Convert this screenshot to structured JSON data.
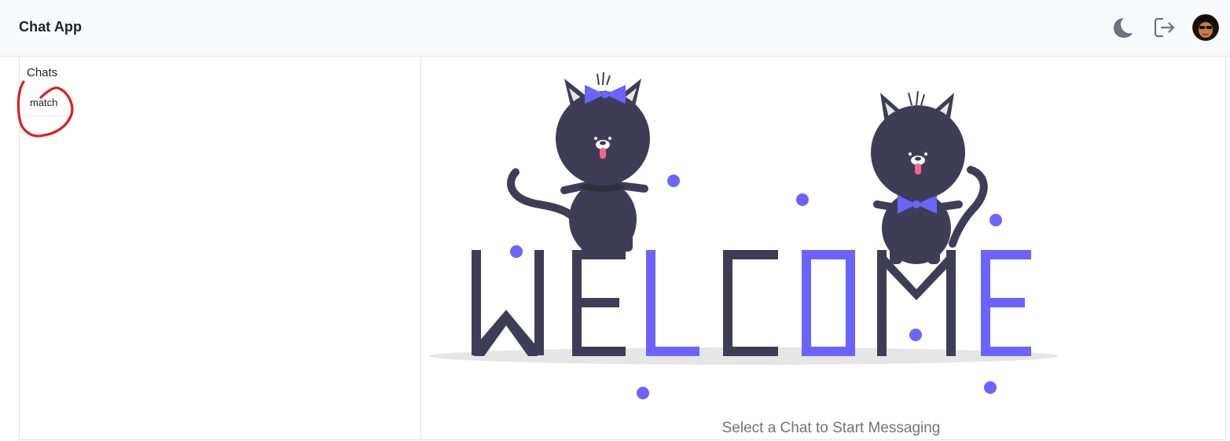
{
  "header": {
    "title": "Chat App",
    "theme_icon": "moon-icon",
    "logout_icon": "logout-icon",
    "avatar_icon": "user-avatar"
  },
  "sidebar": {
    "heading": "Chats",
    "items": [
      {
        "label": "match"
      }
    ]
  },
  "main": {
    "empty_state_text": "Select a Chat to Start Messaging",
    "illustration_text": "WELCOME"
  },
  "colors": {
    "accent": "#6c63ff",
    "dark": "#3f3d56",
    "annotation": "#e11d1d",
    "muted_text": "#6c757d"
  }
}
